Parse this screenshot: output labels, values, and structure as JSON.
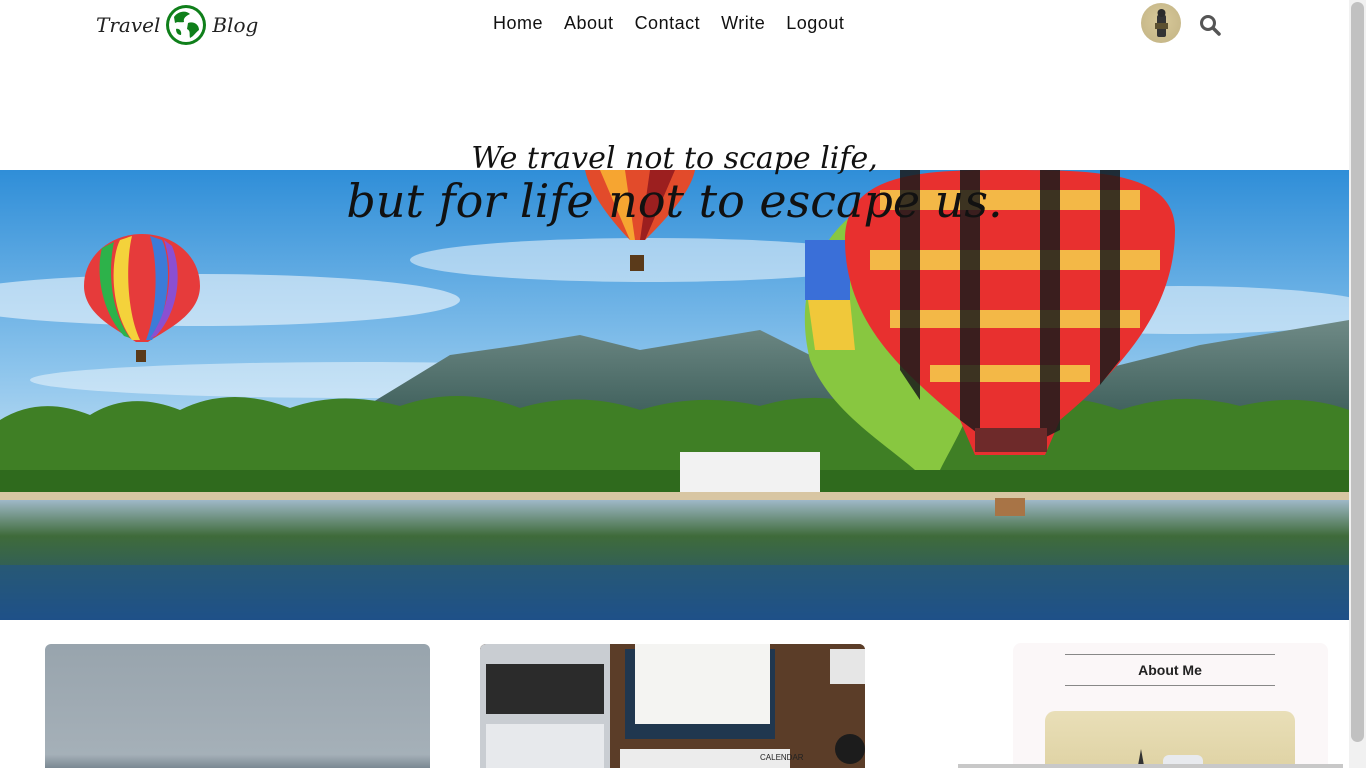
{
  "brand": {
    "word_left": "Travel",
    "word_right": "Blog",
    "globe_color": "#0f7f1a"
  },
  "nav": {
    "items": [
      "Home",
      "About",
      "Contact",
      "Write",
      "Logout"
    ]
  },
  "header": {
    "title_small": "We travel not to scape life,",
    "title_large": "but for life not to escape us."
  },
  "sidebar": {
    "title": "About Me"
  },
  "posts": [
    {
      "image": "sea-horizon"
    },
    {
      "image": "laptop-calendar-desk",
      "caption": "CALENDAR"
    }
  ],
  "icons": {
    "search": "search-icon",
    "globe": "globe-icon",
    "avatar": "user-avatar"
  }
}
